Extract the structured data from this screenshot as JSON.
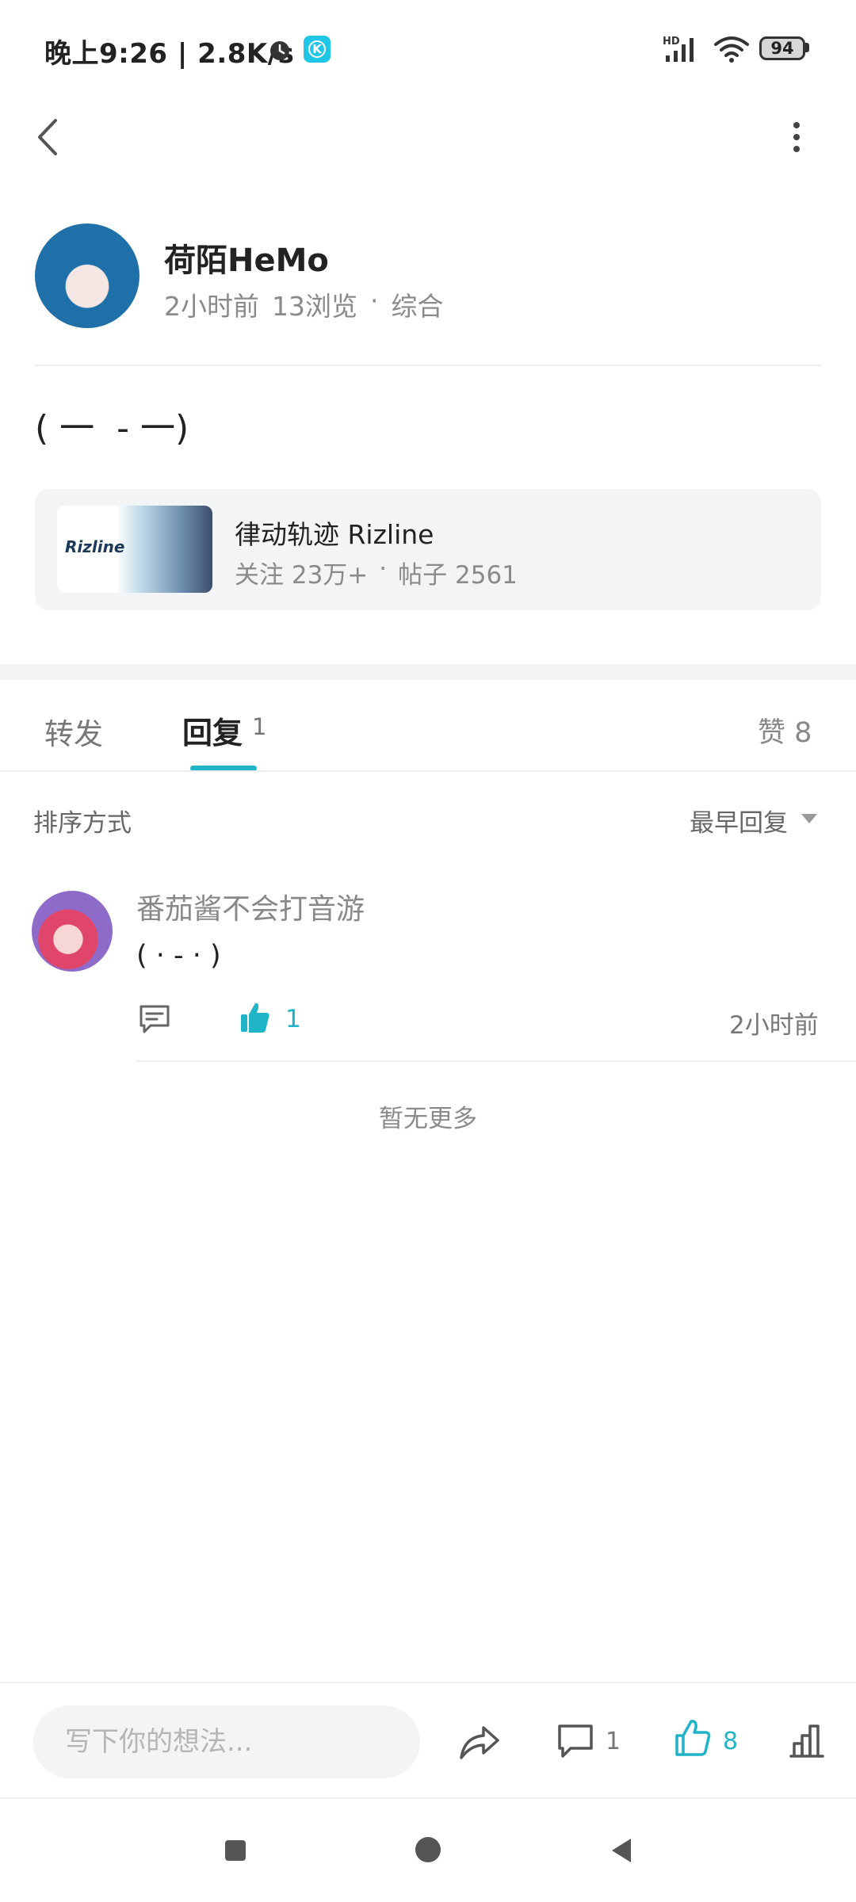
{
  "status_bar": {
    "time_speed": "晚上9:26 | 2.8K/s",
    "app_badge_letter": "K",
    "signal_label": "HD",
    "battery": "94"
  },
  "header": {
    "back_icon": "chevron-left-icon",
    "more_icon": "vertical-dots-icon"
  },
  "author": {
    "name": "荷陌HeMo",
    "time": "2小时前",
    "views": "13浏览",
    "separator": "·",
    "category": "综合"
  },
  "post": {
    "text": "( 一  - 一)"
  },
  "forum": {
    "thumb_logo": "Rizline",
    "name": "律动轨迹 Rizline",
    "followers": "关注 23万+",
    "separator": "·",
    "posts": "帖子 2561"
  },
  "tabs": {
    "forward": "转发",
    "reply": "回复",
    "reply_count": "1",
    "like": "赞 8",
    "active": "reply",
    "accent_color": "#1fb4c7"
  },
  "sort": {
    "label": "排序方式",
    "value": "最早回复"
  },
  "comments": [
    {
      "user": "番茄酱不会打音游",
      "text": "( · - · )",
      "like_count": "1",
      "time": "2小时前"
    }
  ],
  "no_more_text": "暂无更多",
  "bottom_bar": {
    "input_placeholder": "写下你的想法...",
    "comment_count": "1",
    "like_count": "8"
  }
}
